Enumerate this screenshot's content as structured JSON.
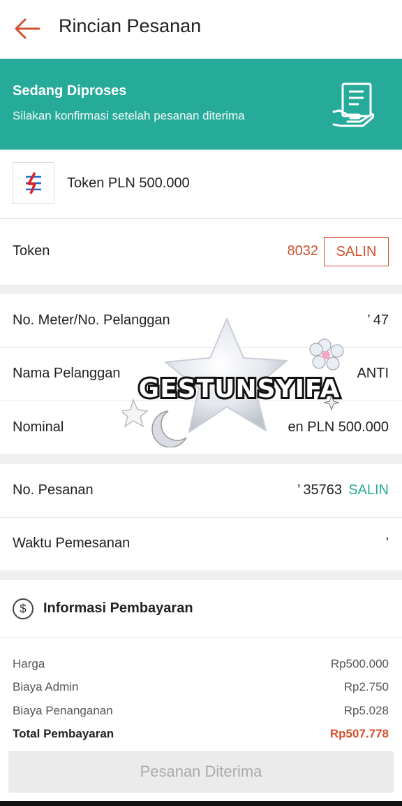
{
  "header": {
    "title": "Rincian Pesanan"
  },
  "status": {
    "title": "Sedang Diproses",
    "subtitle": "Silakan konfirmasi setelah pesanan diterima"
  },
  "product": {
    "name": "Token PLN 500.000"
  },
  "token": {
    "label": "Token",
    "value": "8032",
    "copy_label": "SALIN"
  },
  "details": {
    "meter_label": "No. Meter/No. Pelanggan",
    "meter_value": "’ 47",
    "customer_label": "Nama Pelanggan",
    "customer_value": "ANTI",
    "nominal_label": "Nominal",
    "nominal_value": "en PLN 500.000"
  },
  "order": {
    "number_label": "No. Pesanan",
    "number_value": "’ 35763",
    "copy_label": "SALIN",
    "time_label": "Waktu Pemesanan",
    "time_value": "’"
  },
  "payment": {
    "icon_symbol": "$",
    "title": "Informasi Pembayaran",
    "items": [
      {
        "label": "Harga",
        "value": "Rp500.000"
      },
      {
        "label": "Biaya Admin",
        "value": "Rp2.750"
      },
      {
        "label": "Biaya Penanganan",
        "value": "Rp5.028"
      }
    ],
    "total_label": "Total Pembayaran",
    "total_value": "Rp507.778"
  },
  "action": {
    "received_label": "Pesanan Diterima"
  },
  "watermark": {
    "text": "GESTUNSYIFA"
  },
  "colors": {
    "accent": "#d2512f",
    "teal": "#26aa99",
    "pln_red": "#e02020",
    "pln_blue": "#1c6fd1"
  }
}
